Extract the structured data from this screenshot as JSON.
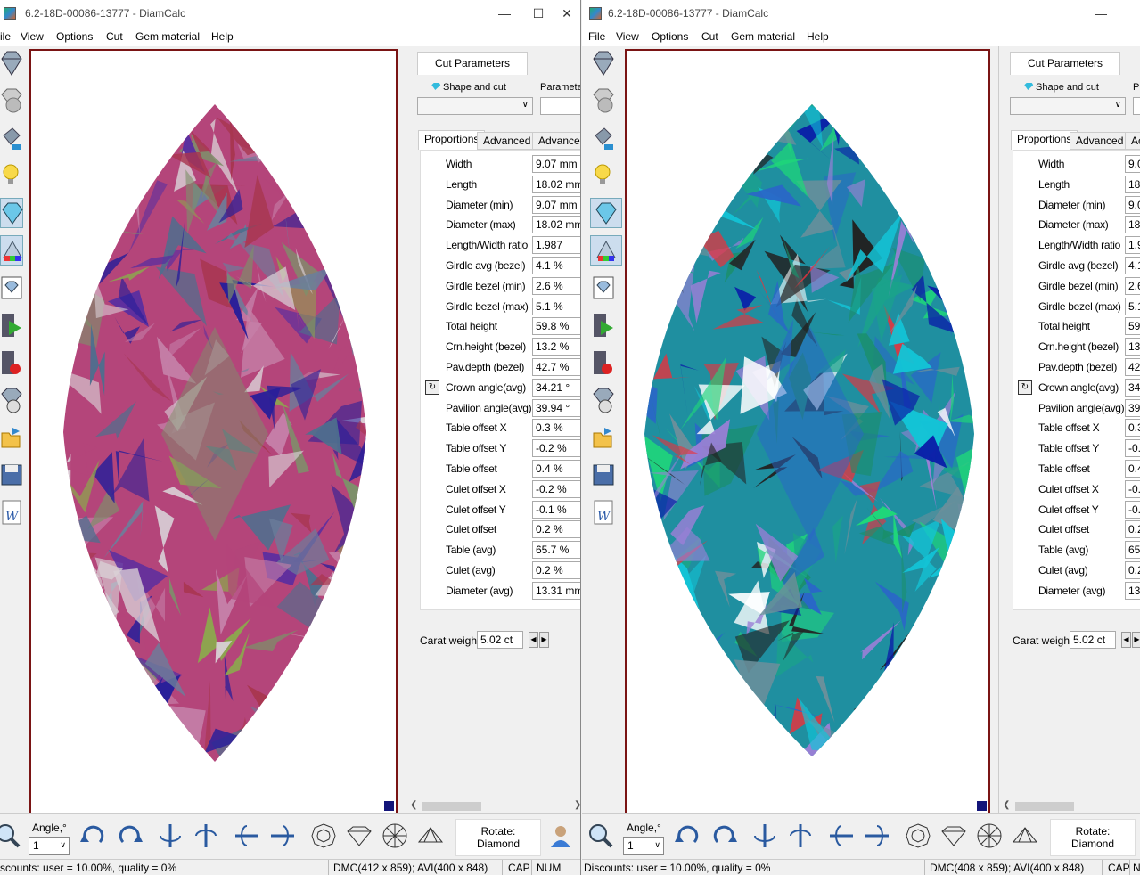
{
  "colors": {
    "viewport_border": "#7a1414",
    "accent": "#3bbbdd"
  },
  "left": {
    "title": "6.2-18D-00086-13777 - DiamCalc",
    "menu": [
      "ile",
      "View",
      "Options",
      "Cut",
      "Gem material",
      "Help"
    ],
    "panel": {
      "tab": "Cut Parameters",
      "shape_label": "Shape and cut",
      "param_label": "Parameters",
      "subtabs": [
        "Proportions",
        "Advanced",
        "Advanced"
      ],
      "rows": [
        {
          "label": "Width",
          "value": "9.07 mm"
        },
        {
          "label": "Length",
          "value": "18.02 mm"
        },
        {
          "label": "Diameter (min)",
          "value": "9.07 mm"
        },
        {
          "label": "Diameter (max)",
          "value": "18.02 mm"
        },
        {
          "label": "Length/Width ratio",
          "value": "1.987"
        },
        {
          "label": "Girdle avg (bezel)",
          "value": "4.1 %"
        },
        {
          "label": "Girdle bezel (min)",
          "value": "2.6 %"
        },
        {
          "label": "Girdle bezel (max)",
          "value": "5.1 %"
        },
        {
          "label": "Total height",
          "value": "59.8 %"
        },
        {
          "label": "Crn.height (bezel)",
          "value": "13.2 %"
        },
        {
          "label": "Pav.depth (bezel)",
          "value": "42.7 %"
        },
        {
          "label": "Crown angle(avg)",
          "value": "34.21 °"
        },
        {
          "label": "Pavilion angle(avg)",
          "value": "39.94 °"
        },
        {
          "label": "Table offset X",
          "value": "0.3 %"
        },
        {
          "label": "Table offset Y",
          "value": "-0.2 %"
        },
        {
          "label": "Table offset",
          "value": "0.4 %"
        },
        {
          "label": "Culet offset X",
          "value": "-0.2 %"
        },
        {
          "label": "Culet offset Y",
          "value": "-0.1 %"
        },
        {
          "label": "Culet offset",
          "value": "0.2 %"
        },
        {
          "label": "Table (avg)",
          "value": "65.7 %"
        },
        {
          "label": "Culet (avg)",
          "value": "0.2 %"
        },
        {
          "label": "Diameter (avg)",
          "value": "13.31 mm"
        }
      ],
      "carat_label": "Carat weight",
      "carat_value": "5.02 ct"
    },
    "bottom": {
      "angle_label": "Angle,°",
      "angle_value": "1",
      "rotate_line1": "Rotate:",
      "rotate_line2": "Diamond"
    },
    "status": {
      "discounts": "scounts: user = 10.00%, quality = 0%",
      "dmc": "DMC(412 x 859); AVI(400 x 848)",
      "cap": "CAP",
      "num": "NUM"
    }
  },
  "right": {
    "title": "6.2-18D-00086-13777 - DiamCalc",
    "menu": [
      "File",
      "View",
      "Options",
      "Cut",
      "Gem material",
      "Help"
    ],
    "panel": {
      "tab": "Cut Parameters",
      "shape_label": "Shape and cut",
      "param_label": "P",
      "subtabs": [
        "Proportions",
        "Advanced",
        "Ac"
      ],
      "rows": [
        {
          "label": "Width",
          "value": "9.0"
        },
        {
          "label": "Length",
          "value": "18"
        },
        {
          "label": "Diameter (min)",
          "value": "9.0"
        },
        {
          "label": "Diameter (max)",
          "value": "18"
        },
        {
          "label": "Length/Width ratio",
          "value": "1.9"
        },
        {
          "label": "Girdle avg (bezel)",
          "value": "4.1"
        },
        {
          "label": "Girdle bezel (min)",
          "value": "2.6"
        },
        {
          "label": "Girdle bezel (max)",
          "value": "5.1"
        },
        {
          "label": "Total height",
          "value": "59"
        },
        {
          "label": "Crn.height (bezel)",
          "value": "13"
        },
        {
          "label": "Pav.depth (bezel)",
          "value": "42"
        },
        {
          "label": "Crown angle(avg)",
          "value": "34"
        },
        {
          "label": "Pavilion angle(avg)",
          "value": "39"
        },
        {
          "label": "Table offset X",
          "value": "0.3"
        },
        {
          "label": "Table offset Y",
          "value": "-0."
        },
        {
          "label": "Table offset",
          "value": "0.4"
        },
        {
          "label": "Culet offset X",
          "value": "-0."
        },
        {
          "label": "Culet offset Y",
          "value": "-0."
        },
        {
          "label": "Culet offset",
          "value": "0.2"
        },
        {
          "label": "Table (avg)",
          "value": "65"
        },
        {
          "label": "Culet (avg)",
          "value": "0.2"
        },
        {
          "label": "Diameter (avg)",
          "value": "13"
        }
      ],
      "carat_label": "Carat weight",
      "carat_value": "5.02 ct"
    },
    "bottom": {
      "angle_label": "Angle,°",
      "angle_value": "1",
      "rotate_line1": "Rotate:",
      "rotate_line2": "Diamond"
    },
    "status": {
      "discounts": "Discounts: user = 10.00%, quality = 0%",
      "dmc": "DMC(408 x 859); AVI(400 x 848)",
      "cap": "CAP",
      "num": "N"
    }
  },
  "icons": {
    "toolbar": [
      "diamond-view-icon",
      "gem-sphere-icon",
      "paint-bucket-icon",
      "light-bulb-icon",
      "diamond-glow-icon",
      "spectrum-icon",
      "diamond-frame-icon",
      "video-play-icon",
      "video-record-icon",
      "diamond-film-icon",
      "open-folder-icon",
      "save-icon",
      "word-export-icon"
    ],
    "bottom": [
      "zoom-icon",
      "rotate-cw-icon",
      "rotate-ccw-icon",
      "flip-horizontal-icon",
      "flip-horizontal-reverse-icon",
      "flip-vertical-icon",
      "flip-vertical-reverse-icon",
      "top-view-icon",
      "side-view-icon",
      "bottom-view-icon",
      "profile-view-icon"
    ]
  }
}
